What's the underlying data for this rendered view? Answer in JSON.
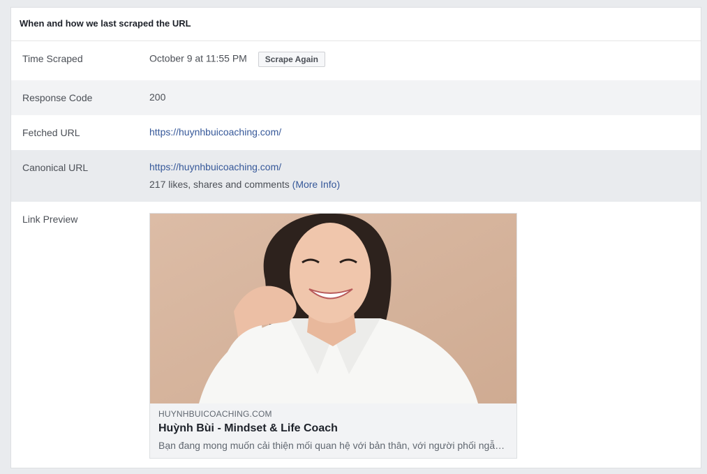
{
  "panel": {
    "title": "When and how we last scraped the URL"
  },
  "rows": {
    "time_scraped": {
      "label": "Time Scraped",
      "value": "October 9 at 11:55 PM",
      "button": "Scrape Again"
    },
    "response_code": {
      "label": "Response Code",
      "value": "200"
    },
    "fetched_url": {
      "label": "Fetched URL",
      "value": "https://huynhbuicoaching.com/"
    },
    "canonical_url": {
      "label": "Canonical URL",
      "value": "https://huynhbuicoaching.com/",
      "engagement_text": "217 likes, shares and comments",
      "more_info": "(More Info)"
    },
    "link_preview": {
      "label": "Link Preview"
    }
  },
  "preview": {
    "domain": "HUYNHBUICOACHING.COM",
    "title": "Huỳnh Bùi - Mindset & Life Coach",
    "description": "Bạn đang mong muốn cải thiện mối quan hệ với bản thân, với người phối ngẫu, với con cái"
  },
  "colors": {
    "link": "#365899",
    "background": "#e9ebee",
    "photo_backdrop": "#d8b9a3"
  }
}
